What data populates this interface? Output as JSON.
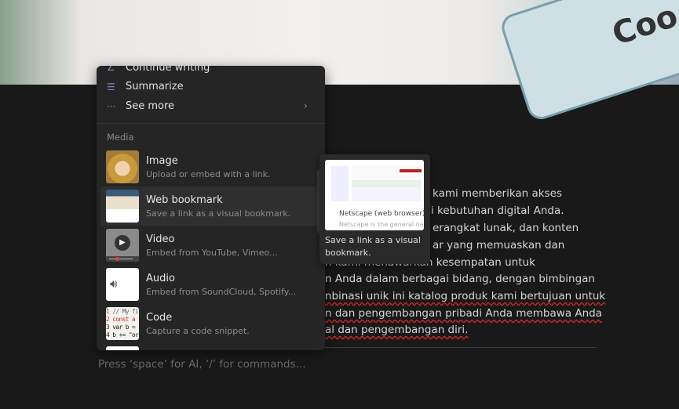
{
  "ai_items": [
    {
      "label": "Continue writing",
      "icon": "pen-icon"
    },
    {
      "label": "Summarize",
      "icon": "summarize-icon"
    },
    {
      "label": "See more",
      "icon": "more-icon"
    }
  ],
  "media_section": "Media",
  "media_items": [
    {
      "title": "Image",
      "desc": "Upload or embed with a link."
    },
    {
      "title": "Web bookmark",
      "desc": "Save a link as a visual bookmark."
    },
    {
      "title": "Video",
      "desc": "Embed from YouTube, Vimeo..."
    },
    {
      "title": "Audio",
      "desc": "Embed from SoundCloud, Spotify..."
    },
    {
      "title": "Code",
      "desc": "Capture a code snippet."
    }
  ],
  "tooltip": {
    "preview_title": "Netscape (web browser) -",
    "preview_sub": "Netscape is the general name for",
    "text": "Save a link as a visual bookmark."
  },
  "body_lines": [
    "kami memberikan akses",
    "i kebutuhan digital Anda.",
    "erangkat lunak, dan konten",
    "ar yang memuaskan dan",
    "n kami menawarkan kesempatan untuk",
    "n Anda dalam berbagai bidang, dengan bimbingan",
    "nbinasi unik ini katalog produk kami bertujuan untuk",
    "n dan pengembangan pribadi Anda membawa Anda",
    "al dan pengembangan diri."
  ],
  "placeholder": "Press ‘space’ for AI, ‘/’ for commands...",
  "code_thumb": [
    "1 // My fi",
    "2 const a",
    "3 var b =",
    "4 b += \"or"
  ],
  "colors": {
    "accent": "#9a7bc4",
    "spellcheck": "#d0252a"
  }
}
